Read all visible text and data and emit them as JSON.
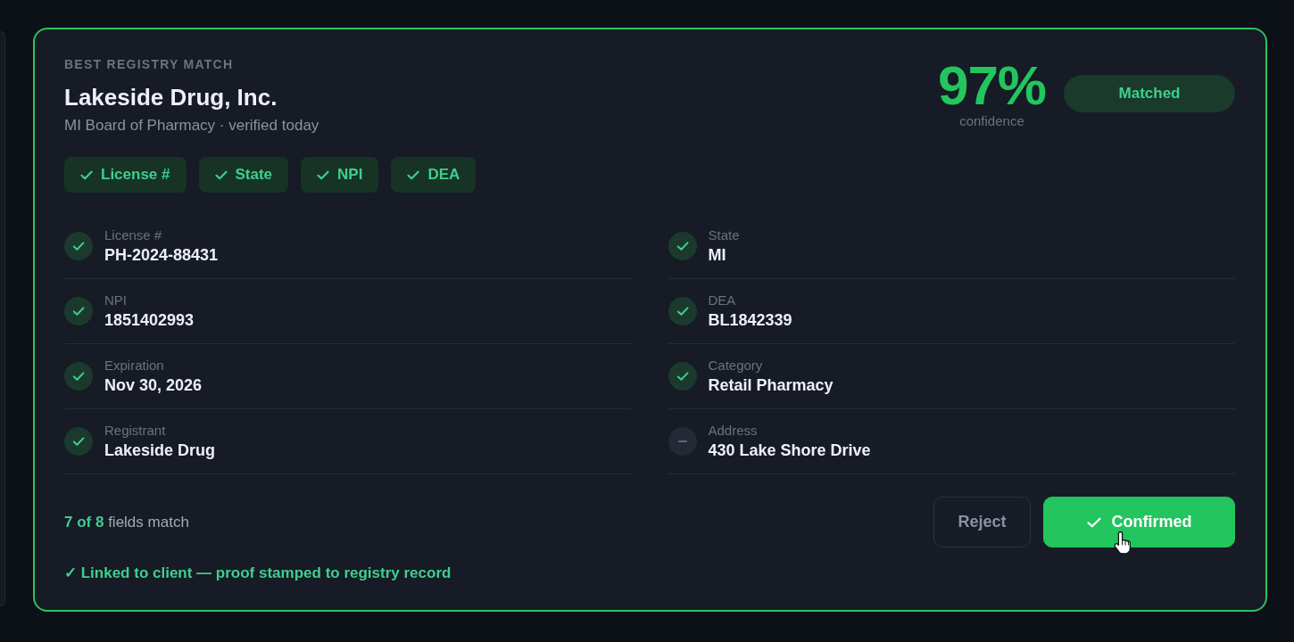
{
  "card": {
    "eyebrow": "BEST REGISTRY MATCH",
    "title": "Lakeside Drug, Inc.",
    "subtitle": "MI Board of Pharmacy · verified today",
    "confidence": {
      "value": "97%",
      "caption": "confidence"
    },
    "status": "Matched",
    "chips": [
      {
        "label": "License #",
        "matched": true
      },
      {
        "label": "State",
        "matched": true
      },
      {
        "label": "NPI",
        "matched": true
      },
      {
        "label": "DEA",
        "matched": true
      }
    ],
    "fields": [
      {
        "label": "License #",
        "value": "PH-2024-88431",
        "matched": true
      },
      {
        "label": "State",
        "value": "MI",
        "matched": true
      },
      {
        "label": "NPI",
        "value": "1851402993",
        "matched": true
      },
      {
        "label": "DEA",
        "value": "BL1842339",
        "matched": true
      },
      {
        "label": "Expiration",
        "value": "Nov 30, 2026",
        "matched": true
      },
      {
        "label": "Category",
        "value": "Retail Pharmacy",
        "matched": true
      },
      {
        "label": "Registrant",
        "value": "Lakeside Drug",
        "matched": true
      },
      {
        "label": "Address",
        "value": "430 Lake Shore Drive",
        "matched": false
      }
    ],
    "summary": "**7 of 8** fields match",
    "buttons": [
      {
        "label": "Reject",
        "kind": "secondary"
      },
      {
        "label": "Confirmed",
        "kind": "primary"
      }
    ],
    "note": "✓ Linked to client — proof stamped to registry record"
  }
}
